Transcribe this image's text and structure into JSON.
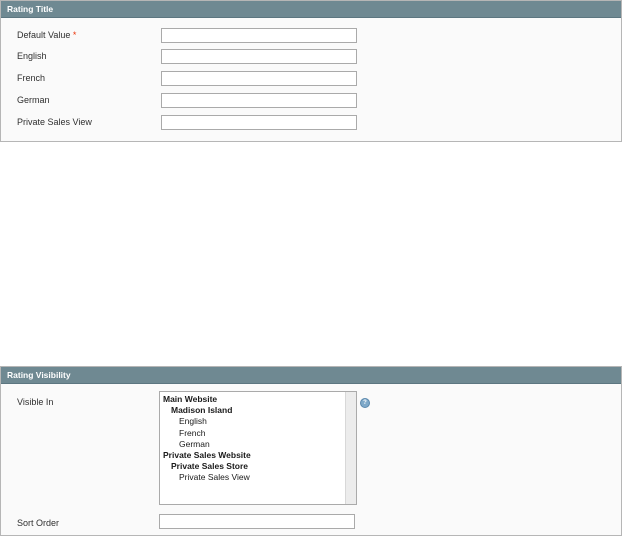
{
  "rating_title": {
    "legend": "Rating Title",
    "fields": [
      {
        "label": "Default Value",
        "required": true,
        "value": ""
      },
      {
        "label": "English",
        "required": false,
        "value": ""
      },
      {
        "label": "French",
        "required": false,
        "value": ""
      },
      {
        "label": "German",
        "required": false,
        "value": ""
      },
      {
        "label": "Private Sales View",
        "required": false,
        "value": ""
      }
    ],
    "required_marker": "*"
  },
  "rating_visibility": {
    "legend": "Rating Visibility",
    "visible_in": {
      "label": "Visible In",
      "options": [
        {
          "label": "Main Website",
          "level": 0
        },
        {
          "label": "Madison Island",
          "level": 1
        },
        {
          "label": "English",
          "level": 2
        },
        {
          "label": "French",
          "level": 2
        },
        {
          "label": "German",
          "level": 2
        },
        {
          "label": "Private Sales Website",
          "level": 0
        },
        {
          "label": "Private Sales Store",
          "level": 1
        },
        {
          "label": "Private Sales View",
          "level": 2
        }
      ],
      "help_icon": "help-icon"
    },
    "sort_order": {
      "label": "Sort Order",
      "value": ""
    }
  }
}
